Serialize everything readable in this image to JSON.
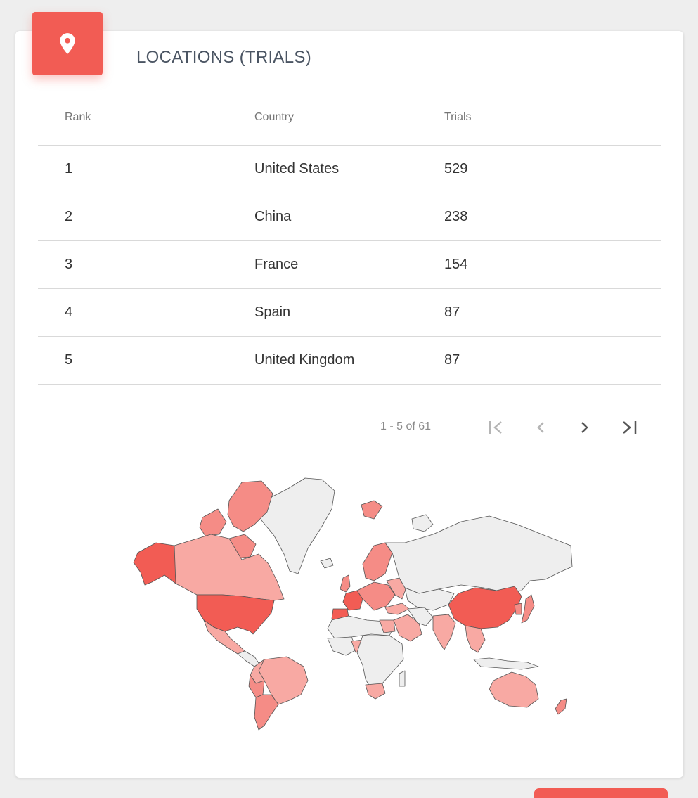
{
  "card": {
    "title": "LOCATIONS (TRIALS)",
    "icon": "location-pin-icon"
  },
  "table": {
    "headers": {
      "rank": "Rank",
      "country": "Country",
      "trials": "Trials"
    },
    "rows": [
      {
        "rank": "1",
        "country": "United States",
        "trials": "529"
      },
      {
        "rank": "2",
        "country": "China",
        "trials": "238"
      },
      {
        "rank": "3",
        "country": "France",
        "trials": "154"
      },
      {
        "rank": "4",
        "country": "Spain",
        "trials": "87"
      },
      {
        "rank": "5",
        "country": "United Kingdom",
        "trials": "87"
      }
    ]
  },
  "pagination": {
    "range_label": "1 - 5 of 61",
    "buttons": [
      "first-page-icon",
      "previous-page-icon",
      "next-page-icon",
      "last-page-icon"
    ]
  },
  "colors": {
    "accent": "#f25c54",
    "map_high": "#f25c54",
    "map_mid": "#f58c86",
    "map_low": "#f8a9a3",
    "map_none": "#eeeeee",
    "map_border": "#555555"
  }
}
